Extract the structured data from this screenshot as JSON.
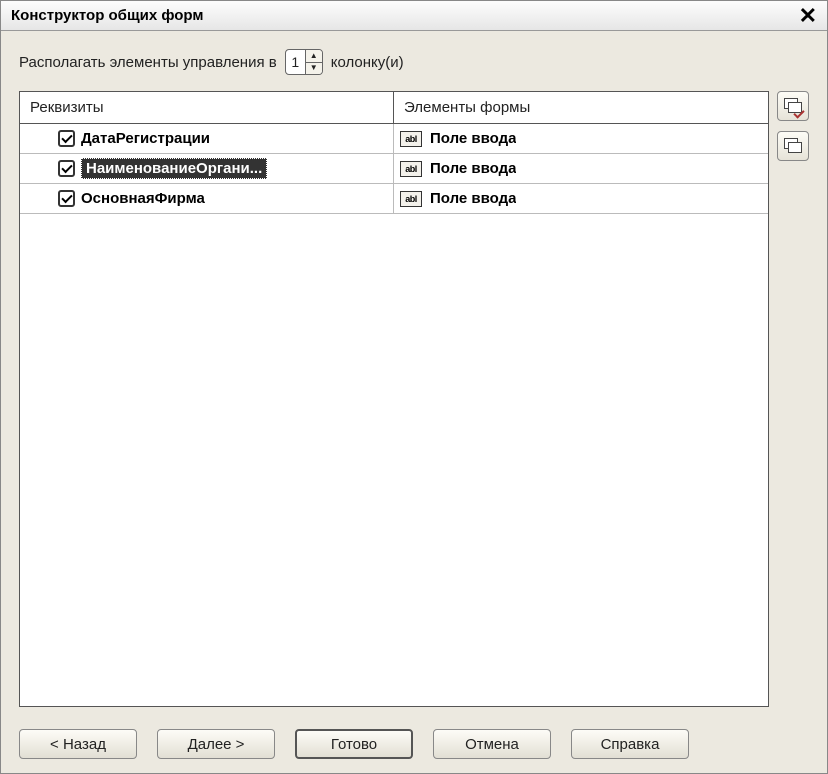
{
  "title": "Конструктор общих форм",
  "layout": {
    "text_before": "Располагать элементы управления в",
    "column_count": "1",
    "text_after": "колонку(и)"
  },
  "table": {
    "header_left": "Реквизиты",
    "header_right": "Элементы формы",
    "rows": [
      {
        "checked": true,
        "name": "ДатаРегистрации",
        "element": "Поле ввода",
        "selected": false
      },
      {
        "checked": true,
        "name": "НаименованиеОргани...",
        "element": "Поле ввода",
        "selected": true
      },
      {
        "checked": true,
        "name": "ОсновнаяФирма",
        "element": "Поле ввода",
        "selected": false
      }
    ]
  },
  "buttons": {
    "back": "< Назад",
    "next": "Далее >",
    "finish": "Готово",
    "cancel": "Отмена",
    "help": "Справка"
  },
  "icons": {
    "abl": "abl"
  }
}
